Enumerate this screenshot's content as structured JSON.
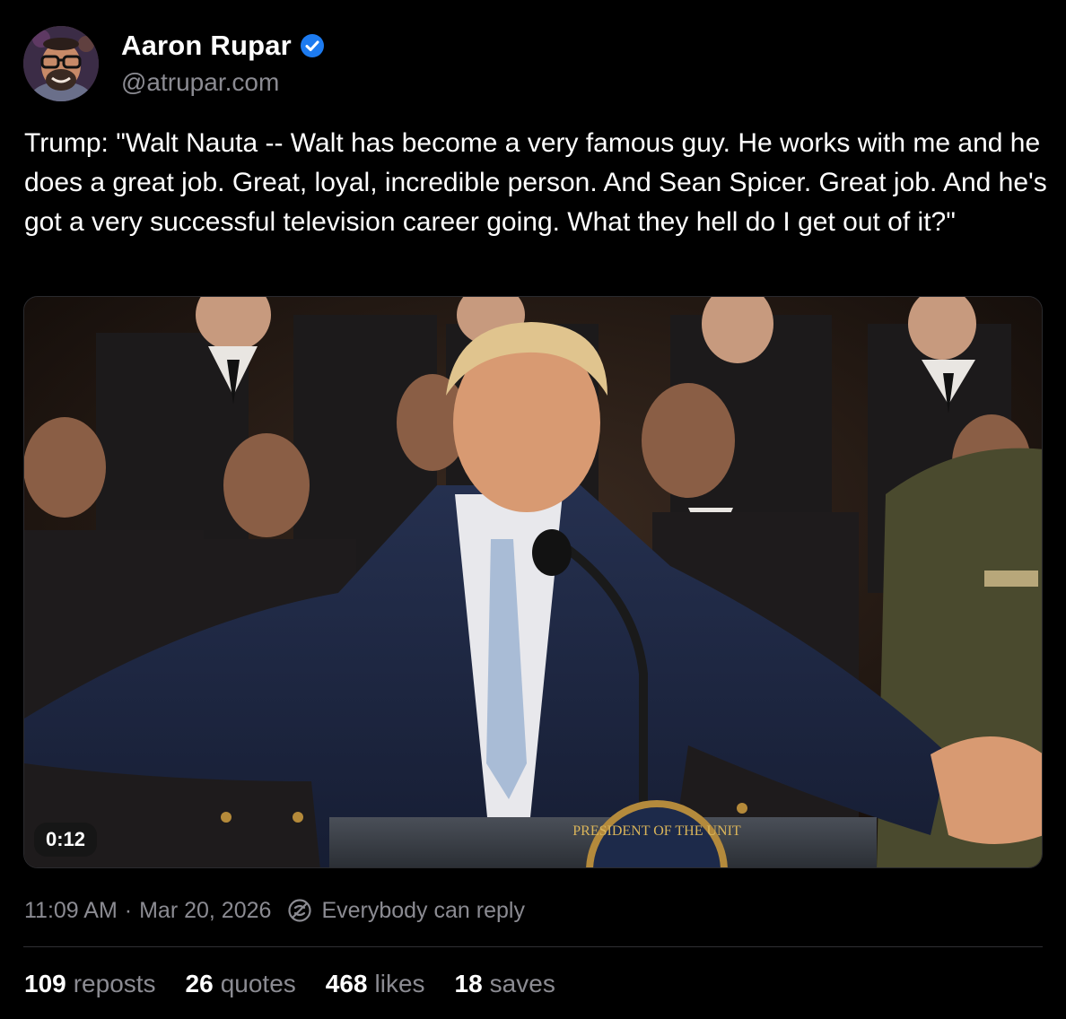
{
  "author": {
    "display_name": "Aaron Rupar",
    "handle": "@atrupar.com",
    "avatar_icon": "avatar-photo",
    "verified_icon": "verified-check-icon",
    "verified_color": "#1d7bf0"
  },
  "post": {
    "text": "Trump: \"Walt Nauta -- Walt has become a very famous guy. He works with me and he does a great job. Great, loyal, incredible person. And Sean Spicer. Great job. And he's got a very successful television career going. What they hell do I get out of it?\""
  },
  "media": {
    "type": "video",
    "duration": "0:12",
    "seal_text": "PRESIDENT OF THE UNIT"
  },
  "meta": {
    "time": "11:09 AM",
    "separator": "·",
    "date": "Mar 20, 2026",
    "reply_setting": "Everybody can reply",
    "reply_icon": "reply-setting-icon"
  },
  "stats": [
    {
      "count": "109",
      "label": "reposts"
    },
    {
      "count": "26",
      "label": "quotes"
    },
    {
      "count": "468",
      "label": "likes"
    },
    {
      "count": "18",
      "label": "saves"
    }
  ],
  "colors": {
    "background": "#000000",
    "text_primary": "#ffffff",
    "text_secondary": "#8b8b92",
    "divider": "#2f2f34"
  }
}
